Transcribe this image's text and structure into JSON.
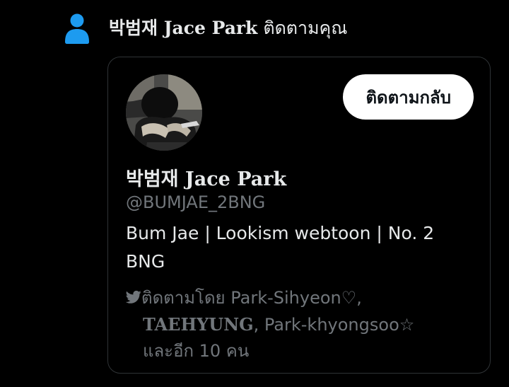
{
  "notification": {
    "icon": "person-icon",
    "icon_color": "#1d9bf0",
    "actor_name": "박범재 Jace Park",
    "action_text": " ติดตามคุณ"
  },
  "card": {
    "avatar": "profile-photo",
    "follow_back_label": "ติดตามกลับ",
    "display_name": "박범재 Jace Park",
    "handle": "@BUMJAE_2BNG",
    "bio": "Bum Jae | Lookism webtoon | No. 2 BNG",
    "followed_by": {
      "icon": "twitter-bird-icon",
      "prefix": "ติดตามโดย ",
      "user1": "Park-Sihyeon♡",
      "sep1": ",",
      "user2": "TAEHYUNG",
      "sep2": ", ",
      "user3": "Park-khyongsoo☆",
      "more": "และอีก 10 คน"
    }
  },
  "colors": {
    "background": "#000000",
    "primary_text": "#e7e9ea",
    "secondary_text": "#71767b",
    "border": "#2f3336",
    "button_bg": "#ffffff",
    "accent": "#1d9bf0"
  }
}
